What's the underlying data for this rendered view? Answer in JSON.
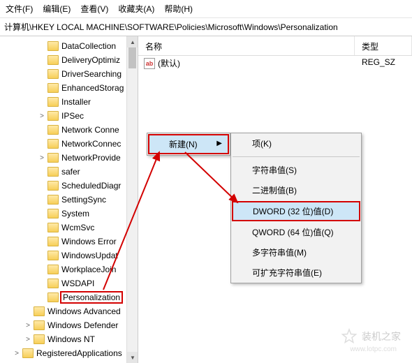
{
  "menu": {
    "file": "文件(F)",
    "edit": "编辑(E)",
    "view": "查看(V)",
    "fav": "收藏夹(A)",
    "help": "帮助(H)"
  },
  "address": "计算机\\HKEY LOCAL MACHINE\\SOFTWARE\\Policies\\Microsoft\\Windows\\Personalization",
  "cols": {
    "name": "名称",
    "type": "类型"
  },
  "row": {
    "icon": "ab",
    "name": "(默认)",
    "type": "REG_SZ"
  },
  "tree": {
    "items": [
      {
        "ind": "ind1",
        "tw": "",
        "label": "DataCollection"
      },
      {
        "ind": "ind1",
        "tw": "",
        "label": "DeliveryOptimiz"
      },
      {
        "ind": "ind1",
        "tw": "",
        "label": "DriverSearching"
      },
      {
        "ind": "ind1",
        "tw": "",
        "label": "EnhancedStorag"
      },
      {
        "ind": "ind1",
        "tw": "",
        "label": "Installer"
      },
      {
        "ind": "ind1",
        "tw": ">",
        "label": "IPSec"
      },
      {
        "ind": "ind1",
        "tw": "",
        "label": "Network Conne"
      },
      {
        "ind": "ind1",
        "tw": "",
        "label": "NetworkConnec"
      },
      {
        "ind": "ind1",
        "tw": ">",
        "label": "NetworkProvide"
      },
      {
        "ind": "ind1",
        "tw": "",
        "label": "safer"
      },
      {
        "ind": "ind1",
        "tw": "",
        "label": "ScheduledDiagr"
      },
      {
        "ind": "ind1",
        "tw": "",
        "label": "SettingSync"
      },
      {
        "ind": "ind1",
        "tw": "",
        "label": "System"
      },
      {
        "ind": "ind1",
        "tw": "",
        "label": "WcmSvc"
      },
      {
        "ind": "ind1",
        "tw": "",
        "label": "Windows Error"
      },
      {
        "ind": "ind1",
        "tw": "",
        "label": "WindowsUpdat"
      },
      {
        "ind": "ind1",
        "tw": "",
        "label": "WorkplaceJoin"
      },
      {
        "ind": "ind1",
        "tw": "",
        "label": "WSDAPI"
      },
      {
        "ind": "ind1",
        "tw": "",
        "label": "Personalization",
        "red": true
      },
      {
        "ind": "ind0",
        "tw": "",
        "label": "Windows Advanced"
      },
      {
        "ind": "ind0",
        "tw": ">",
        "label": "Windows Defender"
      },
      {
        "ind": "ind0",
        "tw": ">",
        "label": "Windows NT"
      },
      {
        "ind": "indm",
        "tw": ">",
        "label": "RegisteredApplications"
      }
    ]
  },
  "ctx1": {
    "new": "新建(N)"
  },
  "ctx2": {
    "key": "项(K)",
    "sz": "字符串值(S)",
    "bin": "二进制值(B)",
    "dword": "DWORD (32 位)值(D)",
    "qword": "QWORD (64 位)值(Q)",
    "multi": "多字符串值(M)",
    "expand": "可扩充字符串值(E)"
  },
  "watermark": {
    "brand": "装机之家",
    "url": "www.lotpc.com"
  }
}
